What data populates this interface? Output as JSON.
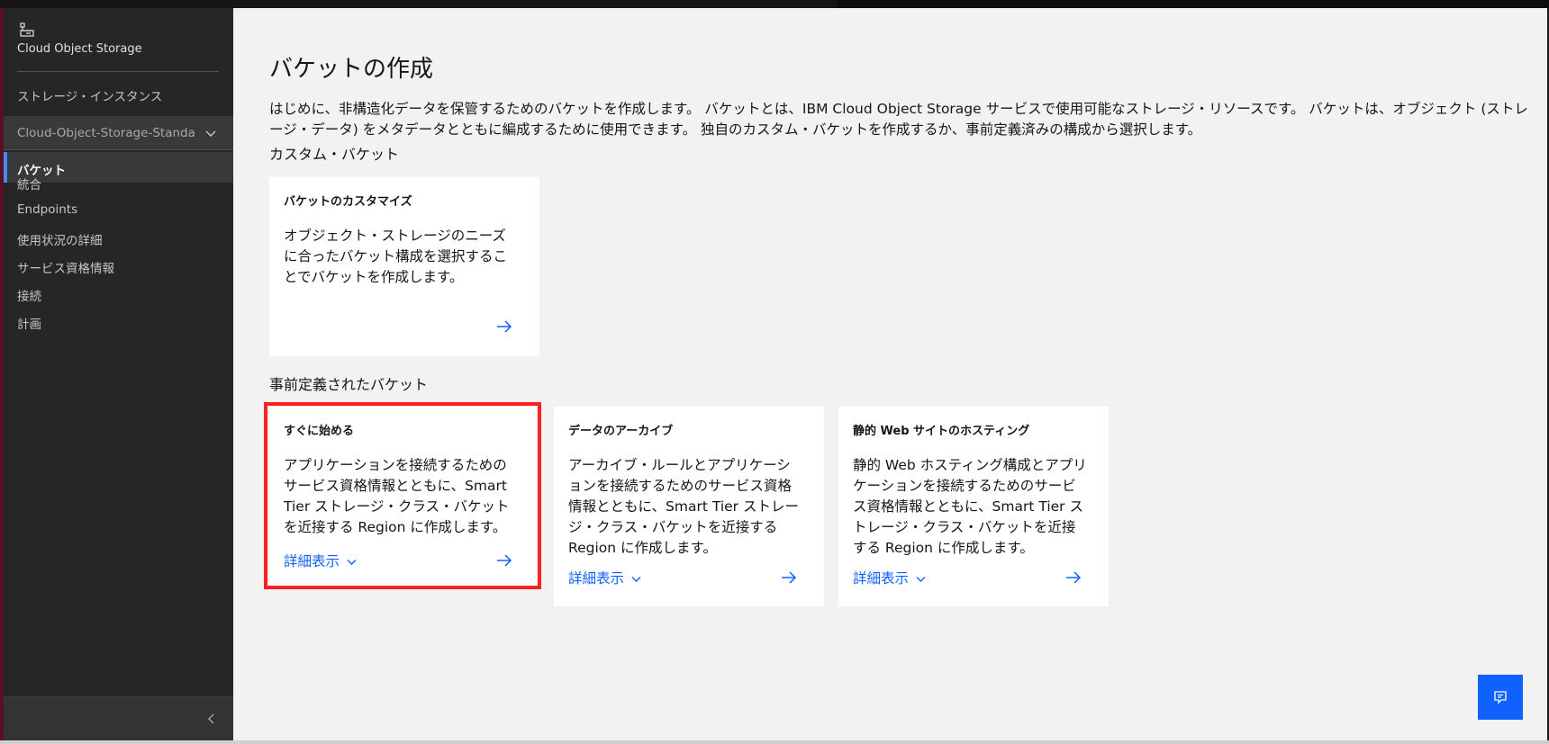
{
  "sidebar": {
    "title": "Cloud Object Storage",
    "storage_instances": "ストレージ・インスタンス",
    "instance_name": "Cloud-Object-Storage-Standa",
    "items": [
      {
        "label": "バケット",
        "active": true
      },
      {
        "label": "統合"
      },
      {
        "label": "Endpoints"
      },
      {
        "label": "使用状況の詳細"
      },
      {
        "label": "サービス資格情報"
      },
      {
        "label": "接続"
      },
      {
        "label": "計画"
      }
    ]
  },
  "main": {
    "title": "バケットの作成",
    "intro": "はじめに、非構造化データを保管するためのバケットを作成します。 バケットとは、IBM Cloud Object Storage サービスで使用可能なストレージ・リソースです。 バケットは、オブジェクト (ストレージ・データ) をメタデータとともに編成するために使用できます。 独自のカスタム・バケットを作成するか、事前定義済みの構成から選択します。",
    "custom_section": "カスタム・バケット",
    "custom_tile": {
      "title": "バケットのカスタマイズ",
      "description": "オブジェクト・ストレージのニーズに合ったバケット構成を選択することでバケットを作成します。"
    },
    "predefined_section": "事前定義されたバケット",
    "predefined_tiles": [
      {
        "title": "すぐに始める",
        "description": "アプリケーションを接続するためのサービス資格情報とともに、Smart Tier ストレージ・クラス・バケットを近接する Region に作成します。",
        "more": "詳細表示",
        "highlighted": true
      },
      {
        "title": "データのアーカイブ",
        "description": "アーカイブ・ルールとアプリケーションを接続するためのサービス資格情報とともに、Smart Tier ストレージ・クラス・バケットを近接する Region に作成します。",
        "more": "詳細表示"
      },
      {
        "title": "静的 Web サイトのホスティング",
        "description": "静的 Web ホスティング構成とアプリケーションを接続するためのサービス資格情報とともに、Smart Tier ストレージ・クラス・バケットを近接する Region に作成します。",
        "more": "詳細表示"
      }
    ]
  },
  "colors": {
    "accent": "#0f62fe",
    "highlight": "#ff2020",
    "sidebar_bg": "#262626"
  },
  "icons": [
    "cloud-object-storage-icon",
    "chevron-down-icon",
    "arrow-right-icon",
    "collapse-chevron-left-icon",
    "feedback-icon"
  ]
}
